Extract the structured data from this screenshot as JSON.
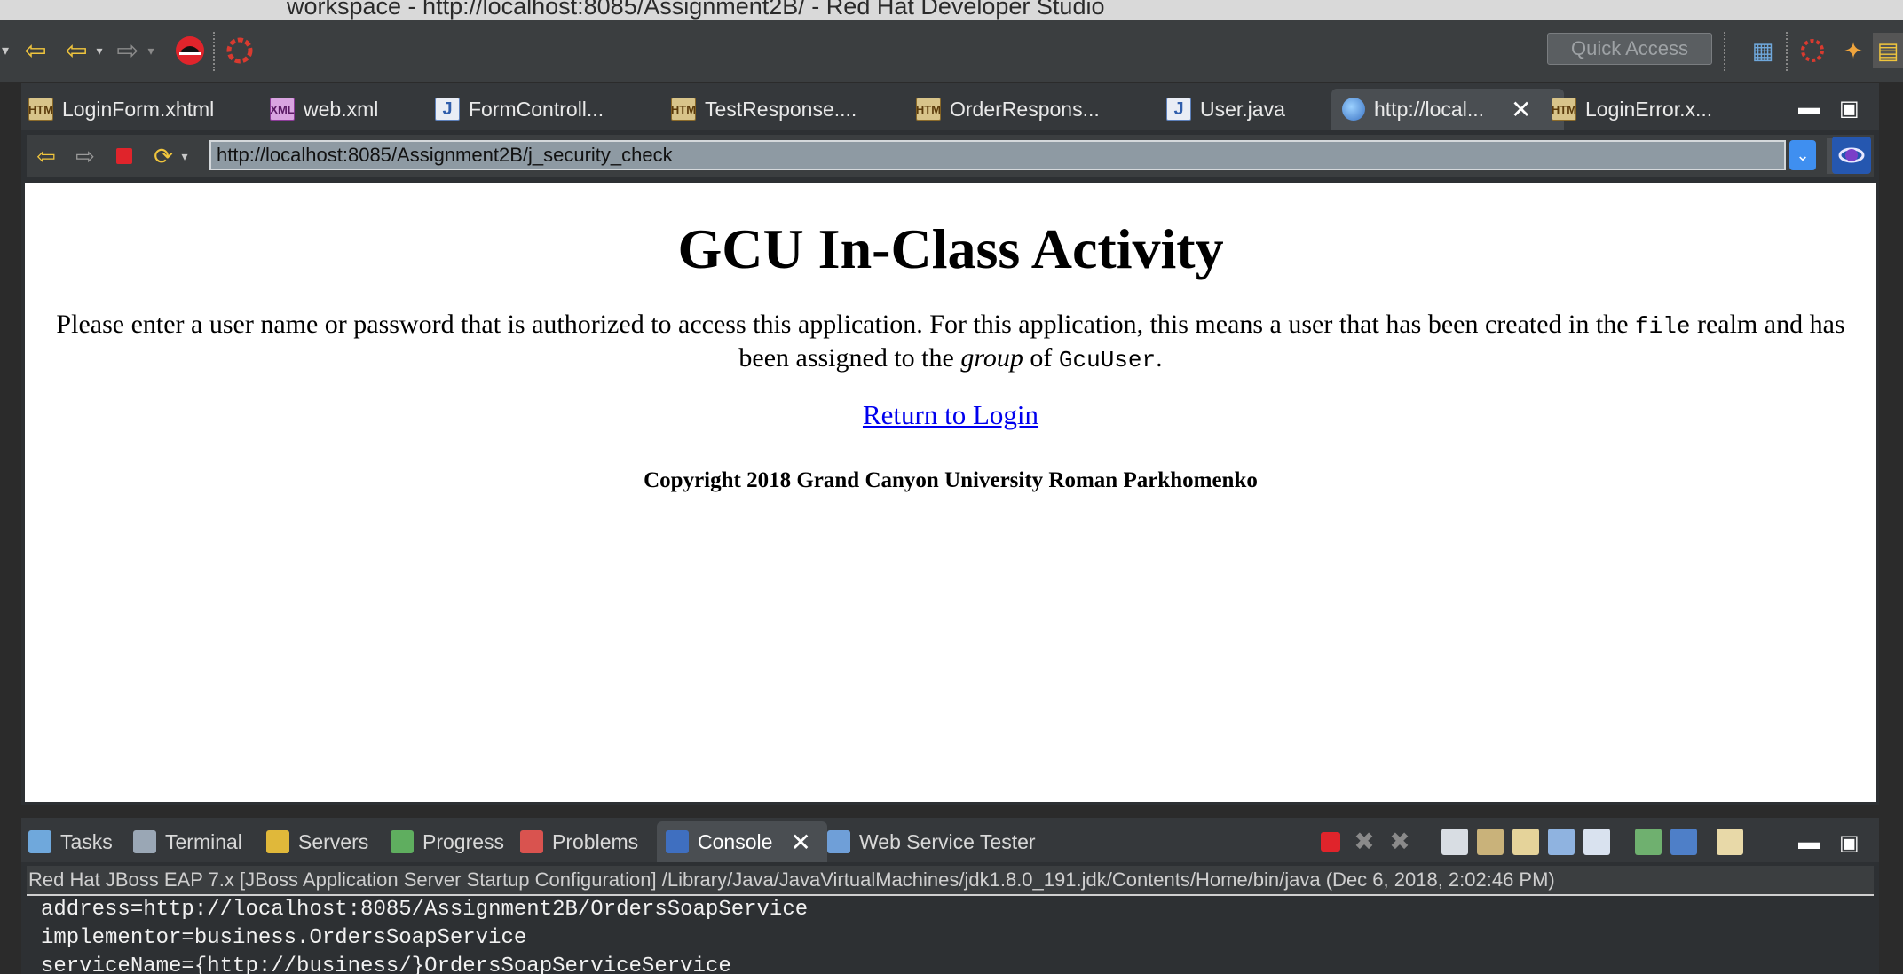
{
  "window": {
    "title": "workspace - http://localhost:8085/Assignment2B/ - Red Hat Developer Studio"
  },
  "toolbar": {
    "quick_access_placeholder": "Quick Access"
  },
  "editor_tabs": [
    {
      "label": "LoginForm.xhtml",
      "icon": "htm-file-icon"
    },
    {
      "label": "web.xml",
      "icon": "xml-file-icon"
    },
    {
      "label": "FormControll...",
      "icon": "java-file-icon"
    },
    {
      "label": "TestResponse....",
      "icon": "htm-file-icon"
    },
    {
      "label": "OrderRespons...",
      "icon": "htm-file-icon"
    },
    {
      "label": "User.java",
      "icon": "java-file-icon"
    },
    {
      "label": "http://local...",
      "icon": "globe-icon",
      "active": true
    },
    {
      "label": "LoginError.x...",
      "icon": "htm-file-icon"
    }
  ],
  "browser": {
    "url": "http://localhost:8085/Assignment2B/j_security_check"
  },
  "page": {
    "heading": "GCU In-Class Activity",
    "msg_part1": "Please enter a user name or password that is authorized to access this application. For this application, this means a user that has been created in the",
    "msg_code1": "file",
    "msg_part2": "realm and has been assigned to the",
    "msg_em": "group",
    "msg_part3": "of",
    "msg_code2": "GcuUser",
    "msg_part4": ".",
    "link": "Return to Login",
    "copyright": "Copyright 2018 Grand Canyon University Roman Parkhomenko"
  },
  "panel_tabs": [
    {
      "label": "Tasks"
    },
    {
      "label": "Terminal"
    },
    {
      "label": "Servers"
    },
    {
      "label": "Progress"
    },
    {
      "label": "Problems"
    },
    {
      "label": "Console",
      "active": true
    },
    {
      "label": "Web Service Tester"
    }
  ],
  "console": {
    "description": "Red Hat JBoss EAP 7.x [JBoss Application Server Startup Configuration] /Library/Java/JavaVirtualMachines/jdk1.8.0_191.jdk/Contents/Home/bin/java (Dec 6, 2018, 2:02:46 PM)",
    "lines": [
      "address=http://localhost:8085/Assignment2B/OrdersSoapService",
      "implementor=business.OrdersSoapService",
      "serviceName={http://business/}OrdersSoapServiceService"
    ]
  }
}
